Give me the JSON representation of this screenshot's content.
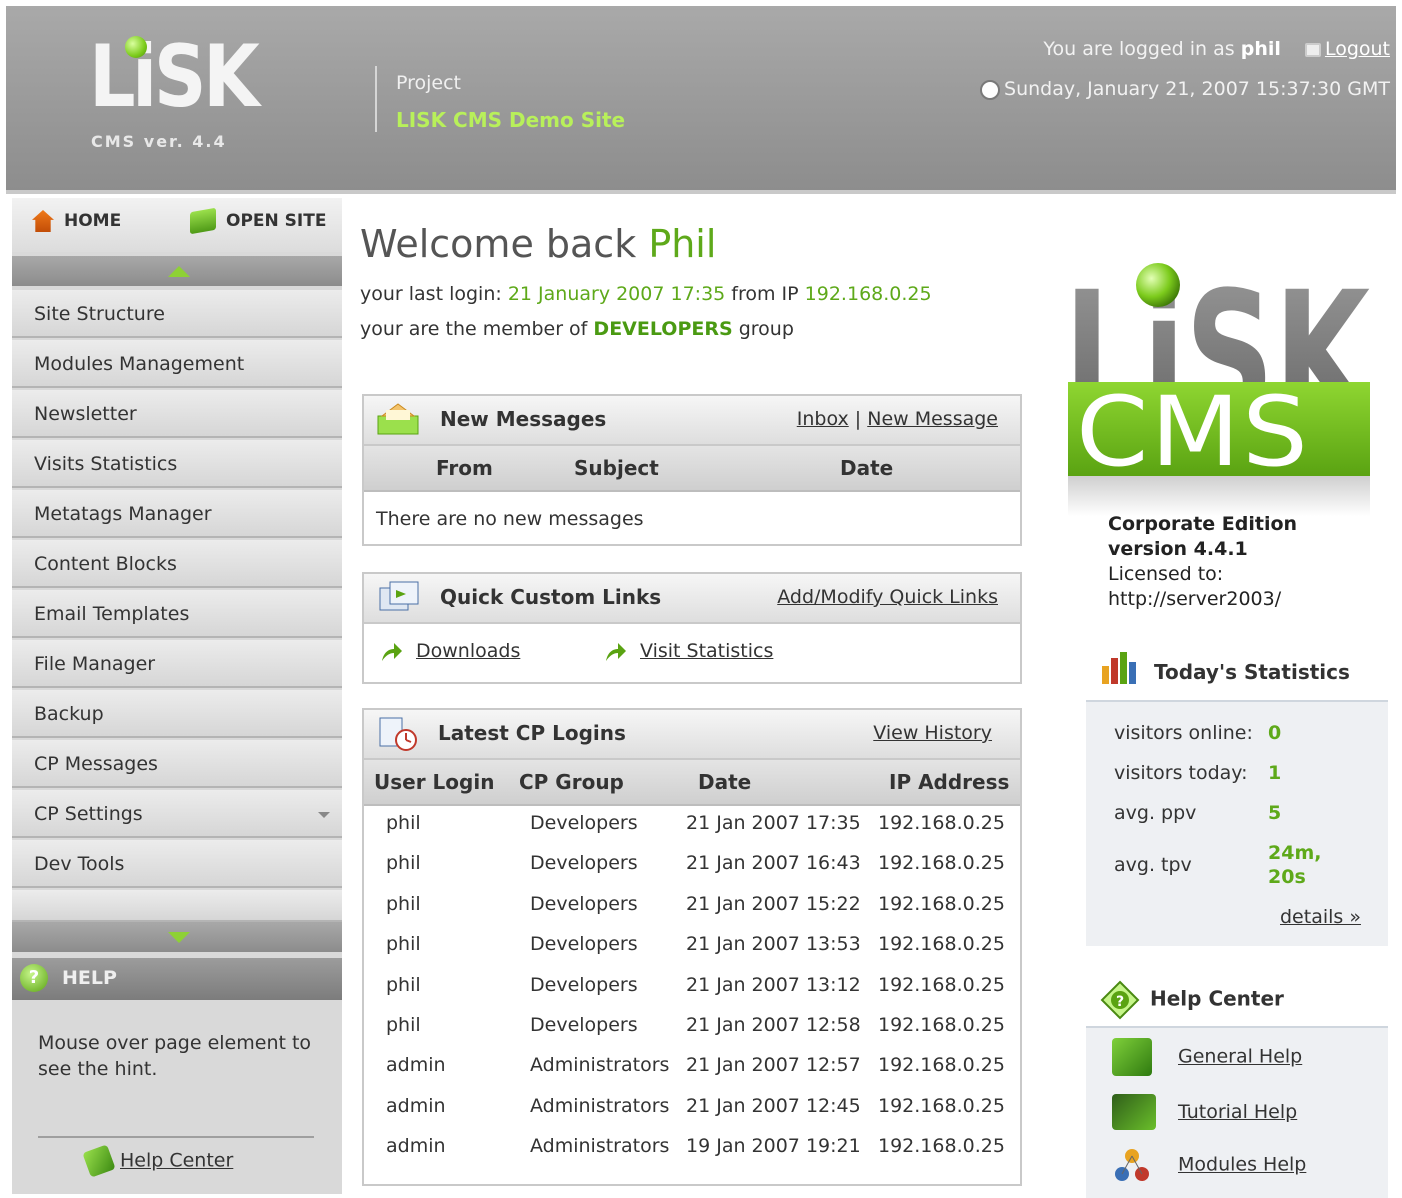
{
  "header": {
    "logo_text": "LiSK",
    "version": "CMS ver. 4.4",
    "project_label": "Project",
    "project_name": "LISK CMS Demo Site",
    "logged_in_prefix": "You are logged in as",
    "username": "phil",
    "logout": "Logout",
    "datetime": "Sunday, January 21, 2007 15:37:30 GMT"
  },
  "topnav": {
    "home": "HOME",
    "open_site": "OPEN SITE"
  },
  "sidebar": {
    "items": [
      {
        "label": "Site Structure"
      },
      {
        "label": "Modules Management"
      },
      {
        "label": "Newsletter"
      },
      {
        "label": "Visits Statistics"
      },
      {
        "label": "Metatags Manager"
      },
      {
        "label": "Content Blocks"
      },
      {
        "label": "Email Templates"
      },
      {
        "label": "File Manager"
      },
      {
        "label": "Backup"
      },
      {
        "label": "CP Messages"
      },
      {
        "label": "CP Settings"
      },
      {
        "label": "Dev Tools"
      }
    ],
    "help_title": "HELP",
    "help_text": "Mouse over page element to see the hint.",
    "help_center": "Help Center"
  },
  "welcome": {
    "prefix": "Welcome back",
    "name": "Phil",
    "last_login_prefix": "your last login:",
    "last_login_date": "21 January 2007 17:35",
    "from_ip": "from IP",
    "ip": "192.168.0.25",
    "member_prefix": "your are the member of",
    "group": "DEVELOPERS",
    "member_suffix": "group"
  },
  "messages": {
    "title": "New Messages",
    "inbox": "Inbox",
    "sep": "|",
    "new_message": "New Message",
    "columns": [
      "From",
      "Subject",
      "Date"
    ],
    "empty": "There are no new messages"
  },
  "quick_links": {
    "title": "Quick Custom Links",
    "manage": "Add/Modify Quick Links",
    "links": [
      "Downloads",
      "Visit Statistics"
    ]
  },
  "logins": {
    "title": "Latest CP Logins",
    "history": "View History",
    "columns": [
      "User Login",
      "CP Group",
      "Date",
      "IP Address"
    ],
    "rows": [
      [
        "phil",
        "Developers",
        "21 Jan 2007 17:35",
        "192.168.0.25"
      ],
      [
        "phil",
        "Developers",
        "21 Jan 2007 16:43",
        "192.168.0.25"
      ],
      [
        "phil",
        "Developers",
        "21 Jan 2007 15:22",
        "192.168.0.25"
      ],
      [
        "phil",
        "Developers",
        "21 Jan 2007 13:53",
        "192.168.0.25"
      ],
      [
        "phil",
        "Developers",
        "21 Jan 2007 13:12",
        "192.168.0.25"
      ],
      [
        "phil",
        "Developers",
        "21 Jan 2007 12:58",
        "192.168.0.25"
      ],
      [
        "admin",
        "Administrators",
        "21 Jan 2007 12:57",
        "192.168.0.25"
      ],
      [
        "admin",
        "Administrators",
        "21 Jan 2007 12:45",
        "192.168.0.25"
      ],
      [
        "admin",
        "Administrators",
        "19 Jan 2007 19:21",
        "192.168.0.25"
      ]
    ]
  },
  "edition": {
    "big_logo": "LiSK",
    "cms": "CMS",
    "line1": "Corporate Edition",
    "line2": "version 4.4.1",
    "line3": "Licensed to:",
    "line4": "http://server2003/"
  },
  "stats": {
    "title": "Today's Statistics",
    "rows": [
      {
        "label": "visitors online:",
        "value": "0"
      },
      {
        "label": "visitors today:",
        "value": "1"
      },
      {
        "label": "avg. ppv",
        "value": "5"
      },
      {
        "label": "avg. tpv",
        "value": "24m,",
        "value2": "20s"
      }
    ],
    "details": "details »"
  },
  "help_center": {
    "title": "Help Center",
    "items": [
      "General Help",
      "Tutorial Help",
      "Modules Help"
    ]
  },
  "colors": {
    "accent_green": "#5ea91a",
    "header_gray": "#9b9b9b"
  }
}
